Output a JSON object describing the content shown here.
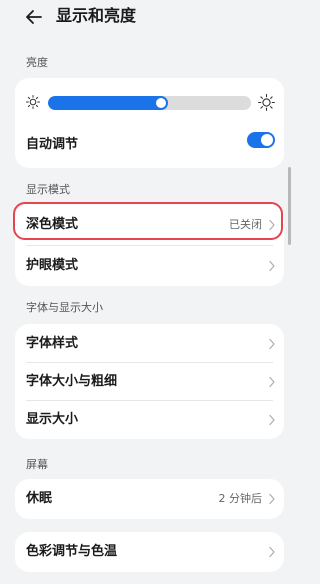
{
  "header": {
    "title": "显示和亮度"
  },
  "brightness": {
    "section_label": "亮度",
    "level_percent": 59,
    "auto_adjust_label": "自动调节",
    "auto_adjust_on": true
  },
  "display_mode": {
    "section_label": "显示模式",
    "items": [
      {
        "label": "深色模式",
        "value": "已关闭"
      },
      {
        "label": "护眼模式",
        "value": ""
      }
    ]
  },
  "font_display": {
    "section_label": "字体与显示大小",
    "items": [
      {
        "label": "字体样式"
      },
      {
        "label": "字体大小与粗细"
      },
      {
        "label": "显示大小"
      }
    ]
  },
  "screen": {
    "section_label": "屏幕",
    "items": [
      {
        "label": "休眠",
        "value": "2 分钟后"
      }
    ]
  },
  "color": {
    "items": [
      {
        "label": "色彩调节与色温"
      }
    ]
  },
  "colors": {
    "accent": "#1a73e8",
    "highlight": "#e6444f",
    "background": "#f1f3f5"
  }
}
